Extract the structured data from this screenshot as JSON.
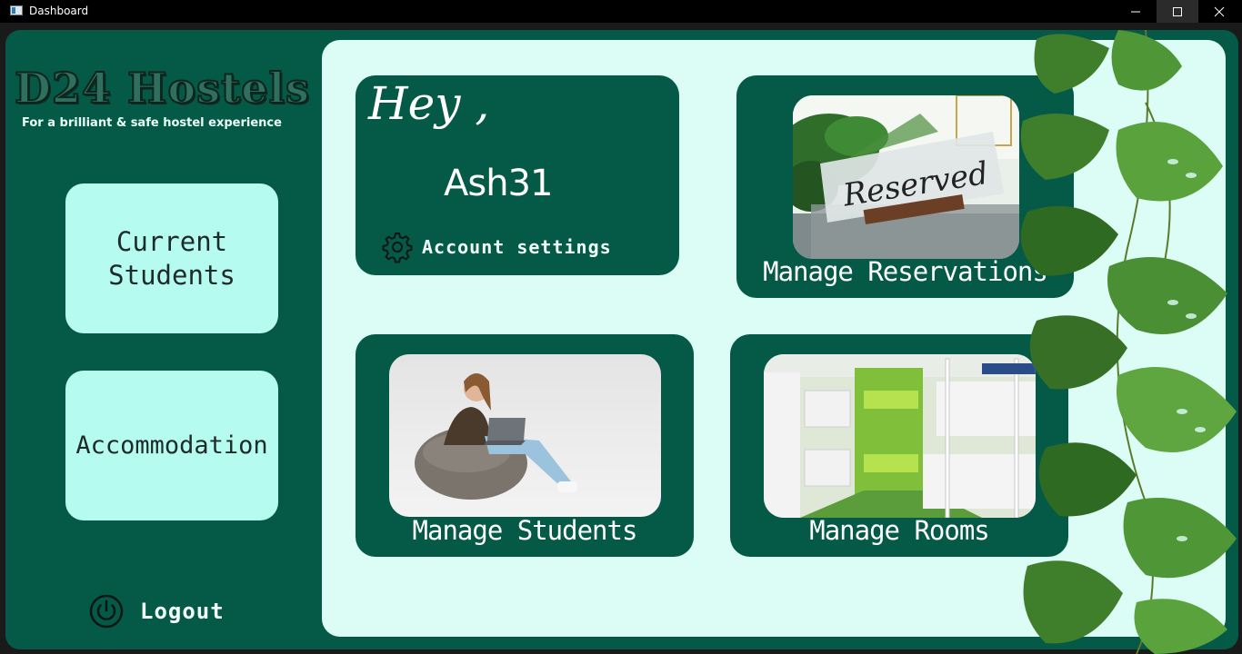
{
  "window": {
    "title": "Dashboard"
  },
  "brand": {
    "name": "D24 Hostels",
    "tagline": "For a brilliant & safe hostel experience"
  },
  "sidebar": {
    "current_students_line1": "Current",
    "current_students_line2": "Students",
    "accommodation": "Accommodation",
    "logout": "Logout"
  },
  "greeting": {
    "hey": "Hey ,",
    "username": "Ash31",
    "account_settings": "Account settings"
  },
  "tiles": {
    "reservations": {
      "label": "Manage Reservations",
      "sign_text": "Reserved"
    },
    "students": {
      "label": "Manage Students"
    },
    "rooms": {
      "label": "Manage Rooms"
    }
  },
  "colors": {
    "dark_green": "#045a46",
    "mint": "#b6fbef",
    "panel": "#dcfdf6"
  }
}
